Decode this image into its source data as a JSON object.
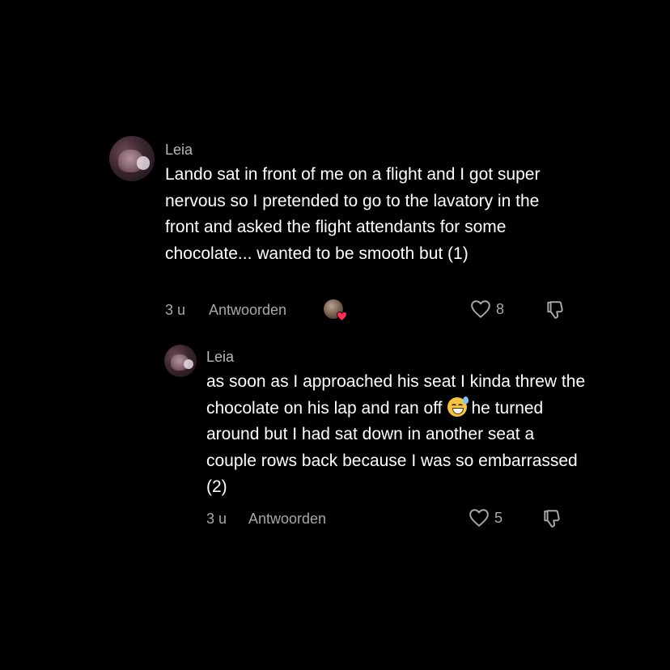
{
  "comments": [
    {
      "username": "Leia",
      "text": "Lando sat in front of me on a flight and I got super nervous so I pretended to go to the lavatory in the front and asked the flight attendants for some chocolate... wanted to be smooth but (1)",
      "time": "3 u",
      "reply_label": "Antwoorden",
      "likes": "8",
      "creator_liked": true
    }
  ],
  "reply": {
    "username": "Leia",
    "text_part1": "as soon as I approached his seat I kinda threw the chocolate on his lap and ran off",
    "emoji": "sweat-smile-emoji",
    "text_part2": "he turned around but I had sat down in another seat a couple rows back because I was so embarrassed (2)",
    "time": "3 u",
    "reply_label": "Antwoorden",
    "likes": "5"
  },
  "icons": {
    "like": "heart-outline-icon",
    "dislike": "thumbs-down-icon",
    "creator_badge": "creator-heart-icon"
  },
  "colors": {
    "background": "#000000",
    "text": "#ffffff",
    "secondary": "#a8a8a8",
    "heart_red": "#ff2d55"
  }
}
